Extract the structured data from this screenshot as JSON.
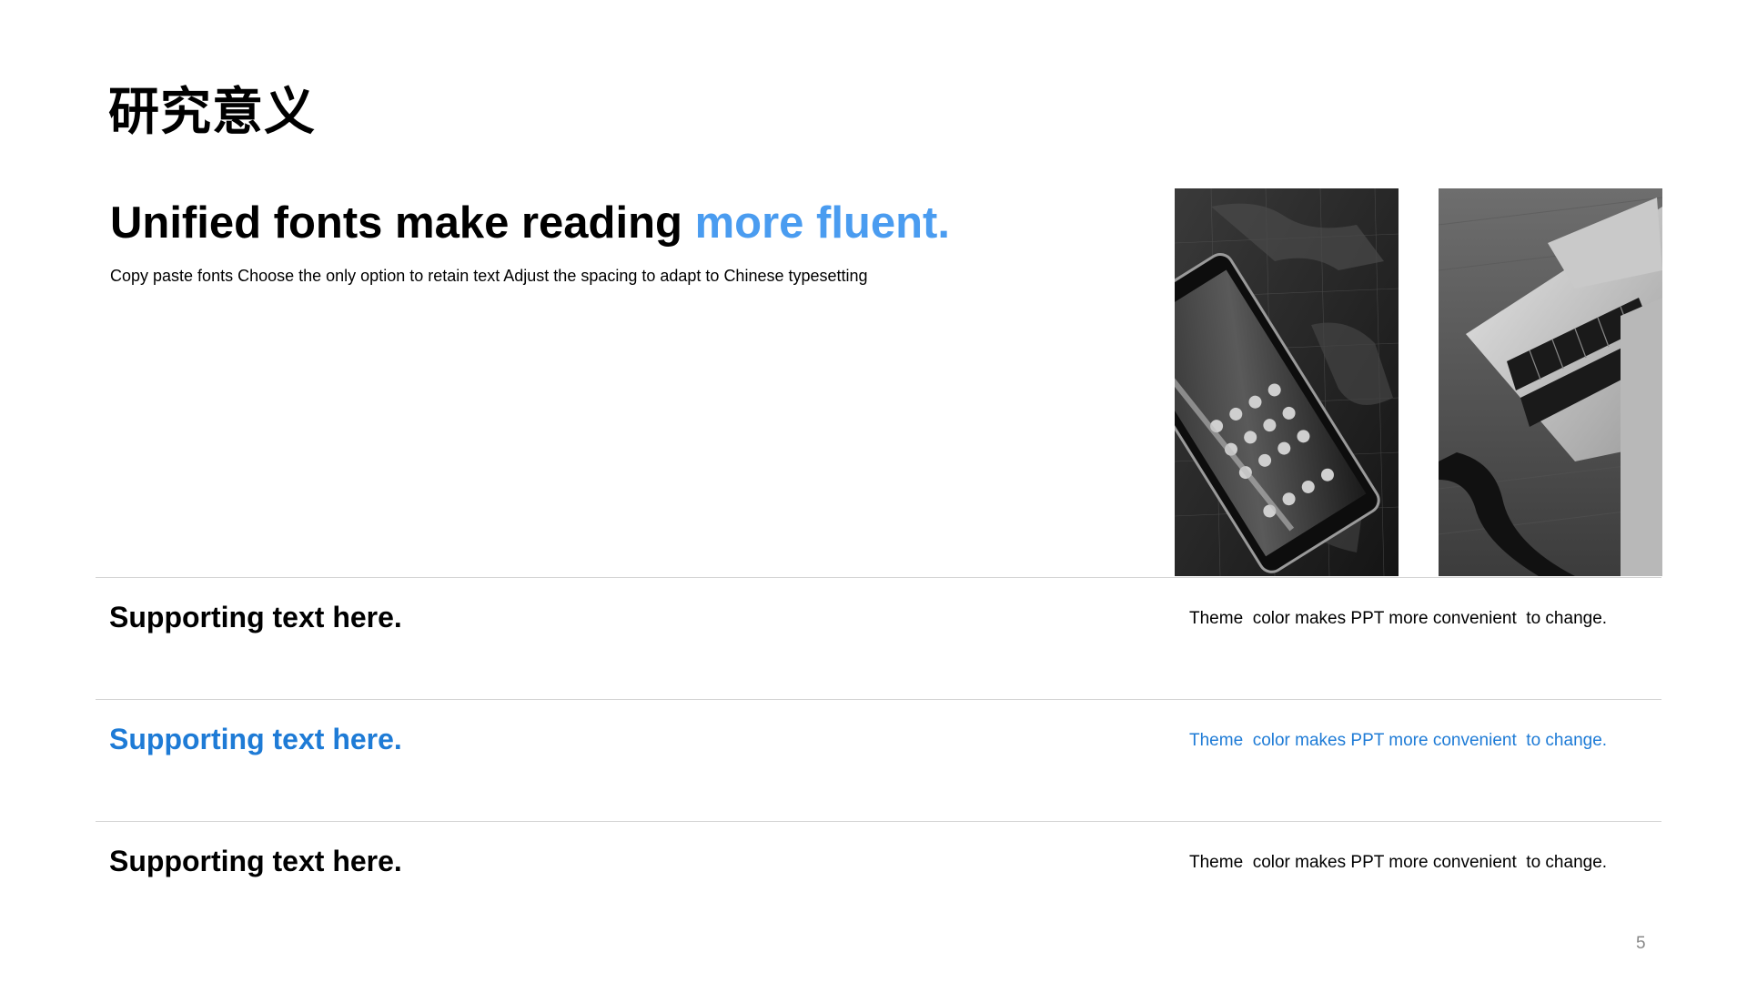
{
  "slide": {
    "title": "研究意义",
    "headline_main": "Unified fonts make reading ",
    "headline_accent": "more fluent.",
    "subtitle": "Copy paste fonts Choose the only option to retain text Adjust the spacing to adapt to Chinese typesetting",
    "page_number": "5"
  },
  "rows": [
    {
      "label": "Supporting text here.",
      "note": "Theme  color makes PPT more convenient  to change."
    },
    {
      "label": "Supporting text here.",
      "note": "Theme  color makes PPT more convenient  to change."
    },
    {
      "label": "Supporting text here.",
      "note": "Theme  color makes PPT more convenient  to change."
    }
  ],
  "colors": {
    "accent": "#4a9cf0",
    "highlight_row": "#1e7bd6",
    "divider": "#d4d4d4"
  },
  "images": [
    {
      "icon": "smartphone-on-world-map-photo"
    },
    {
      "icon": "laptop-keyboard-photo"
    }
  ]
}
